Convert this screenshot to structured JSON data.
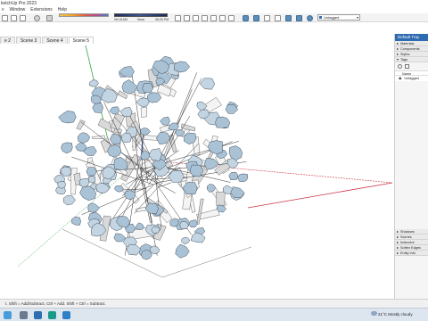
{
  "window": {
    "title": "ketchUp Pro 2023"
  },
  "menu": [
    "v",
    "Window",
    "Extensions",
    "Help"
  ],
  "shadow_panel": {
    "months": "J F M A M J J A S O N D",
    "time_start": "06:18 AM",
    "time_mid": "Noon",
    "time_end": "06:25 PM"
  },
  "tag_select": {
    "value": "Untagged"
  },
  "tabs": [
    {
      "label": "e 2",
      "active": false
    },
    {
      "label": "Scene 3",
      "active": false
    },
    {
      "label": "Scene 4",
      "active": false
    },
    {
      "label": "Scene 5",
      "active": true
    }
  ],
  "tray": {
    "title": "Default Tray",
    "top_items": [
      "Materials",
      "Components",
      "Styles",
      "Tags"
    ],
    "tags_header": "Name",
    "tags_row": "Untagged",
    "bottom_items": [
      "Shadows",
      "Scenes",
      "Instructor",
      "Soften Edges",
      "Entity Info"
    ]
  },
  "status": {
    "message": "t. Shift = Add/Subtract. Ctrl + Add. Shift + Ctrl = Subtract."
  },
  "taskbar": {
    "weather": "21°C  Mostly cloudy"
  },
  "colors": {
    "accent": "#2f6bb0",
    "axis_red": "#cc3344",
    "axis_green": "#33aa44",
    "axis_blue": "#3355cc",
    "leaf": "#a9c2d6",
    "leaf_edge": "#44505c"
  }
}
